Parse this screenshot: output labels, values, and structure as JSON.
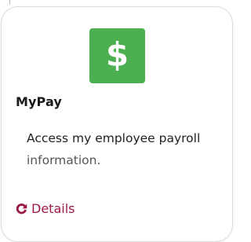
{
  "card": {
    "icon": {
      "name": "dollar-sign-icon",
      "glyph": "$",
      "color": "#4caf50"
    },
    "title": "MyPay",
    "description_line1": "Access my employee payroll",
    "description_line2": "information.",
    "details_link": {
      "label": "Details",
      "icon": "refresh-icon",
      "color": "#9b1b45"
    }
  }
}
